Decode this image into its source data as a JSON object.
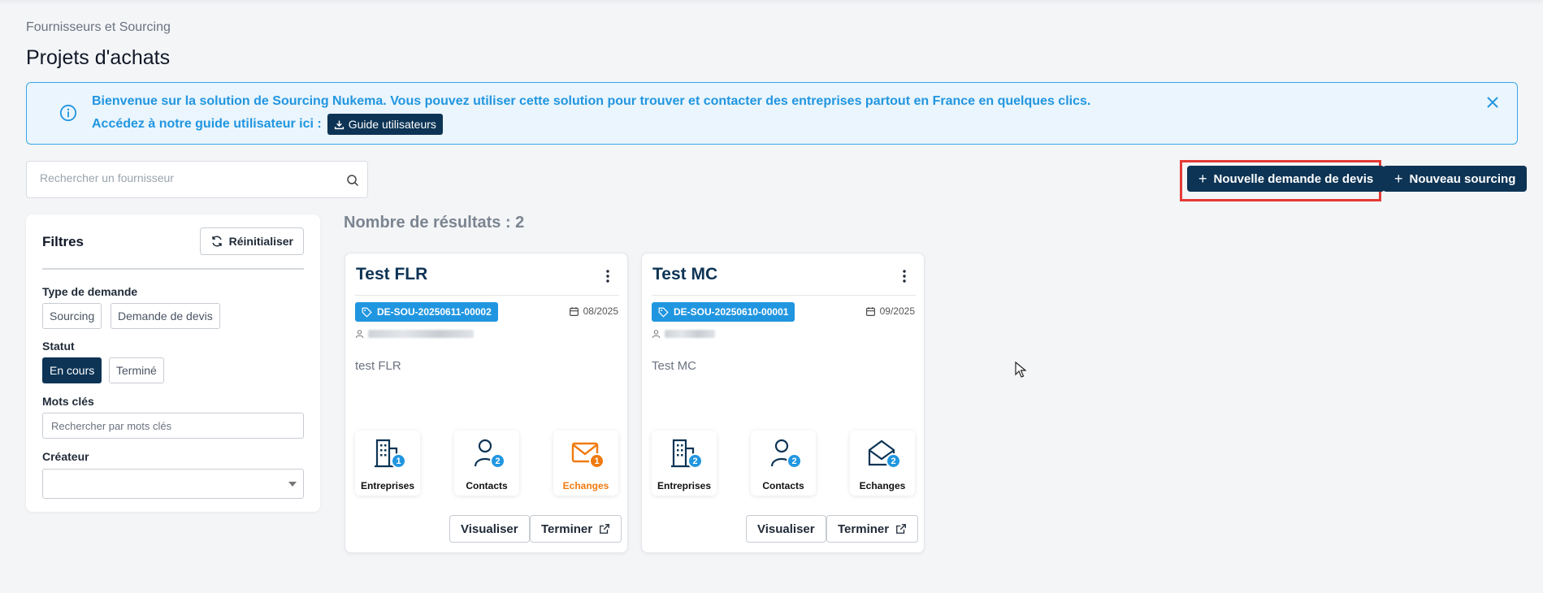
{
  "breadcrumb": "Fournisseurs et Sourcing",
  "title": "Projets d'achats",
  "info": {
    "line1": "Bienvenue sur la solution de Sourcing Nukema. Vous pouvez utiliser cette solution pour trouver et contacter des entreprises partout en France en quelques clics.",
    "line2": "Accédez à notre guide utilisateur ici :",
    "guide_button": "Guide utilisateurs"
  },
  "search": {
    "placeholder": "Rechercher un fournisseur"
  },
  "actions": {
    "new_quote": "Nouvelle demande de devis",
    "new_sourcing": "Nouveau sourcing"
  },
  "filters": {
    "title": "Filtres",
    "reset": "Réinitialiser",
    "type_label": "Type de demande",
    "type_options": [
      "Sourcing",
      "Demande de devis"
    ],
    "status_label": "Statut",
    "status_options": [
      "En cours",
      "Terminé"
    ],
    "status_selected": "En cours",
    "keywords_label": "Mots clés",
    "keywords_placeholder": "Rechercher par mots clés",
    "creator_label": "Créateur",
    "creator_value": ""
  },
  "results_label": "Nombre de résultats : 2",
  "cards": [
    {
      "title": "Test FLR",
      "reference": "DE-SOU-20250611-00002",
      "date": "08/2025",
      "description": "test FLR",
      "tiles": [
        {
          "label": "Entreprises",
          "count": "1",
          "icon": "building-icon"
        },
        {
          "label": "Contacts",
          "count": "2",
          "icon": "person-icon"
        },
        {
          "label": "Echanges",
          "count": "1",
          "icon": "mail-icon",
          "highlight_color": "#f07a10"
        }
      ],
      "view_button": "Visualiser",
      "finish_button": "Terminer"
    },
    {
      "title": "Test MC",
      "reference": "DE-SOU-20250610-00001",
      "date": "09/2025",
      "description": "Test MC",
      "tiles": [
        {
          "label": "Entreprises",
          "count": "2",
          "icon": "building-icon"
        },
        {
          "label": "Contacts",
          "count": "2",
          "icon": "person-icon"
        },
        {
          "label": "Echanges",
          "count": "2",
          "icon": "mail-open-icon"
        }
      ],
      "view_button": "Visualiser",
      "finish_button": "Terminer"
    }
  ],
  "colors": {
    "primary_dark": "#0d3455",
    "accent_blue": "#2196e0",
    "accent_orange": "#f07a10",
    "highlight_red": "#e53935"
  }
}
